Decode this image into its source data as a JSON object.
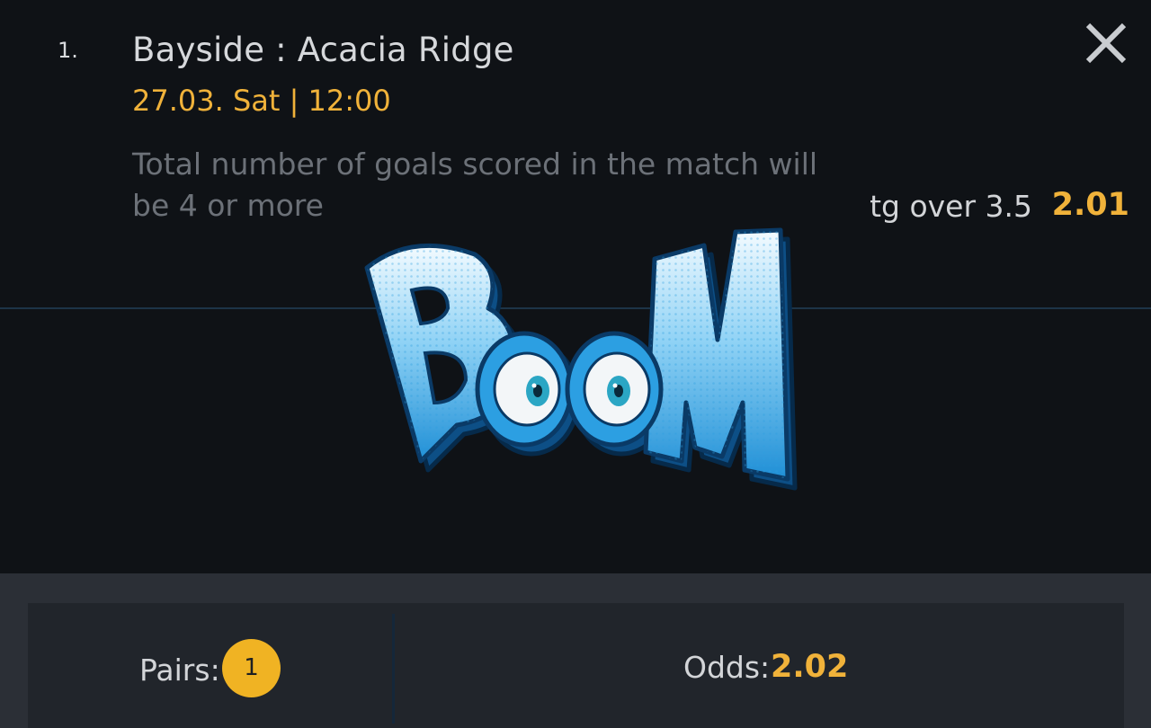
{
  "bet": {
    "index": "1.",
    "match": "Bayside : Acacia Ridge",
    "datetime": "27.03. Sat | 12:00",
    "market_description": "Total number of goals scored in the match will be 4 or more",
    "selection": "tg over 3.5",
    "odds": "2.01"
  },
  "overlay": {
    "sticker_text": "BOOM"
  },
  "footer": {
    "pairs_label": "Pairs:",
    "pairs_count": "1",
    "odds_label": "Odds:",
    "odds_total": "2.02"
  },
  "colors": {
    "accent": "#f0b23a",
    "badge": "#f0b323",
    "background": "#0f1216",
    "footer_bg": "#2b2f36",
    "panel_bg": "#21252b",
    "sticker_blue": "#1f8fd6"
  },
  "icons": {
    "close": "close-icon"
  }
}
